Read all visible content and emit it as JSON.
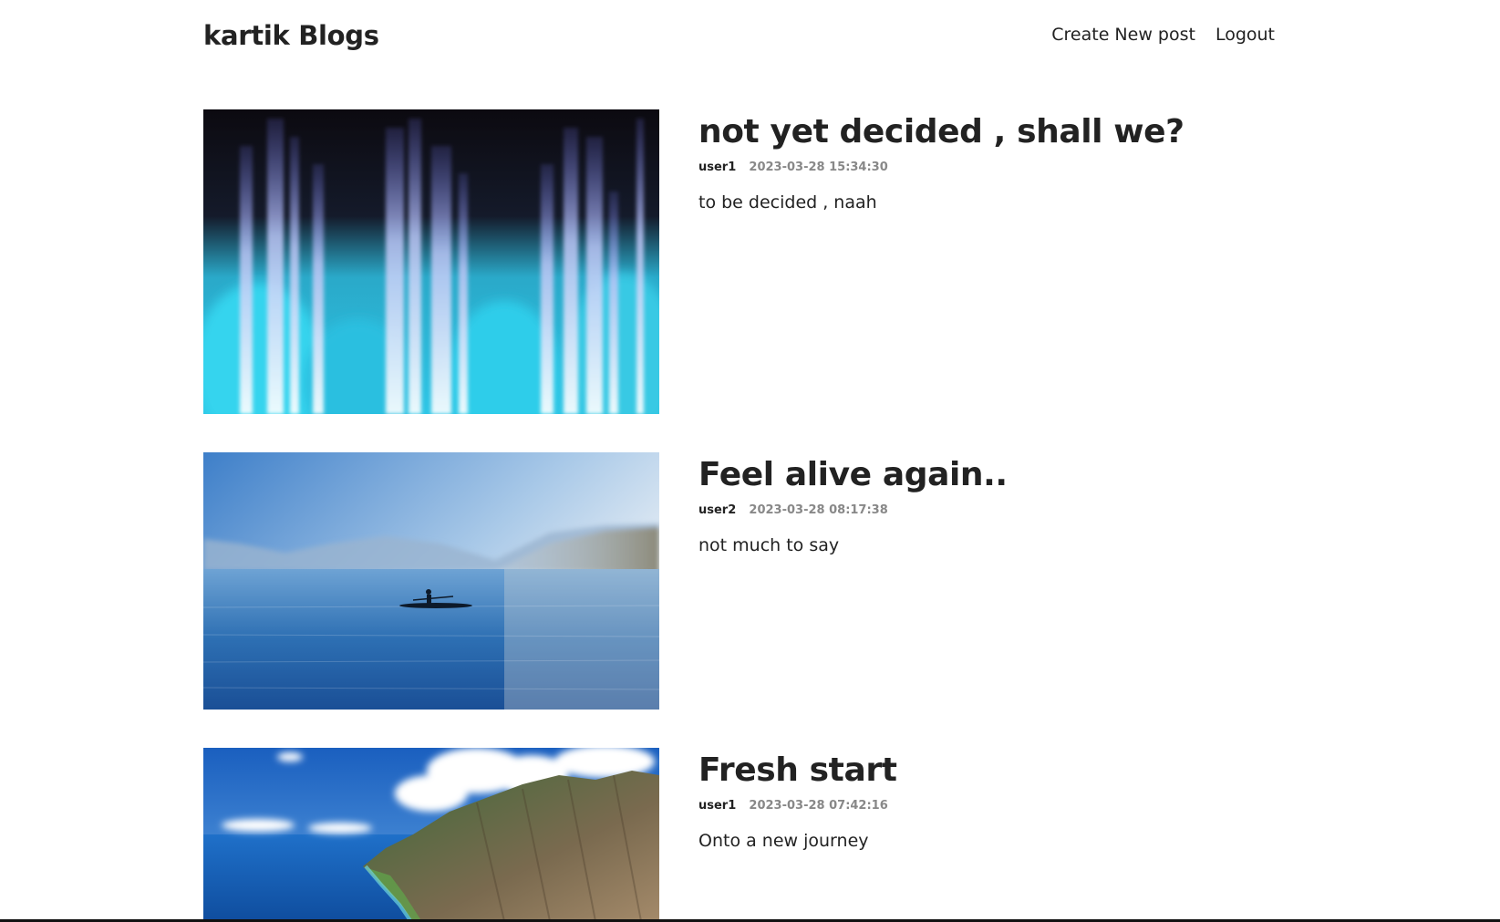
{
  "header": {
    "site_title": "kartik Blogs",
    "nav": {
      "create_label": "Create New post",
      "logout_label": "Logout"
    }
  },
  "posts": [
    {
      "title": "not yet decided , shall we?",
      "author": "user1",
      "timestamp": "2023-03-28 15:34:30",
      "summary": "to be decided , naah"
    },
    {
      "title": "Feel alive again..",
      "author": "user2",
      "timestamp": "2023-03-28 08:17:38",
      "summary": "not much to say"
    },
    {
      "title": "Fresh start",
      "author": "user1",
      "timestamp": "2023-03-28 07:42:16",
      "summary": "Onto a new journey"
    }
  ]
}
